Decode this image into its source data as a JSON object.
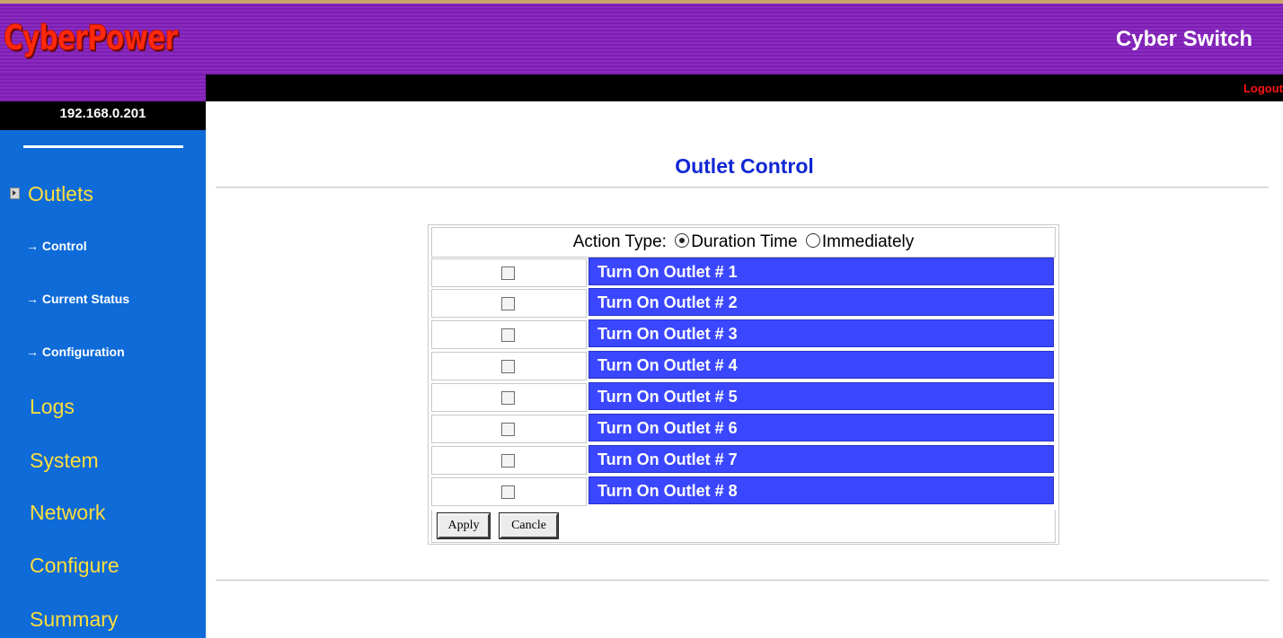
{
  "header": {
    "logo_text": "CyberPower",
    "app_title": "Cyber Switch",
    "logout_label": "Logout"
  },
  "sidebar": {
    "ip_address": "192.168.0.201",
    "items": [
      {
        "label": "Outlets",
        "active": true
      },
      {
        "label": "→ Control"
      },
      {
        "label": "→ Current Status"
      },
      {
        "label": "→ Configuration"
      },
      {
        "label": "Logs"
      },
      {
        "label": "System"
      },
      {
        "label": "Network"
      },
      {
        "label": "Configure"
      },
      {
        "label": "Summary"
      }
    ]
  },
  "main": {
    "page_title": "Outlet Control",
    "action_type": {
      "label": "Action Type:",
      "options": [
        {
          "label": "Duration Time",
          "selected": true
        },
        {
          "label": "Immediately",
          "selected": false
        }
      ]
    },
    "outlets": [
      {
        "label": "Turn On Outlet # 1",
        "checked": false
      },
      {
        "label": "Turn On Outlet # 2",
        "checked": false
      },
      {
        "label": "Turn On Outlet # 3",
        "checked": false
      },
      {
        "label": "Turn On Outlet # 4",
        "checked": false
      },
      {
        "label": "Turn On Outlet # 5",
        "checked": false
      },
      {
        "label": "Turn On Outlet # 6",
        "checked": false
      },
      {
        "label": "Turn On Outlet # 7",
        "checked": false
      },
      {
        "label": "Turn On Outlet # 8",
        "checked": false
      }
    ],
    "buttons": {
      "apply_label": "Apply",
      "cancel_label": "Cancle"
    }
  },
  "colors": {
    "header_purple": "#7d1fb2",
    "sidebar_blue": "#0e6bd8",
    "nav_yellow": "#ffde3c",
    "outlet_blue": "#3b47ff",
    "title_blue": "#1027d4",
    "logout_red": "#ff1414"
  }
}
